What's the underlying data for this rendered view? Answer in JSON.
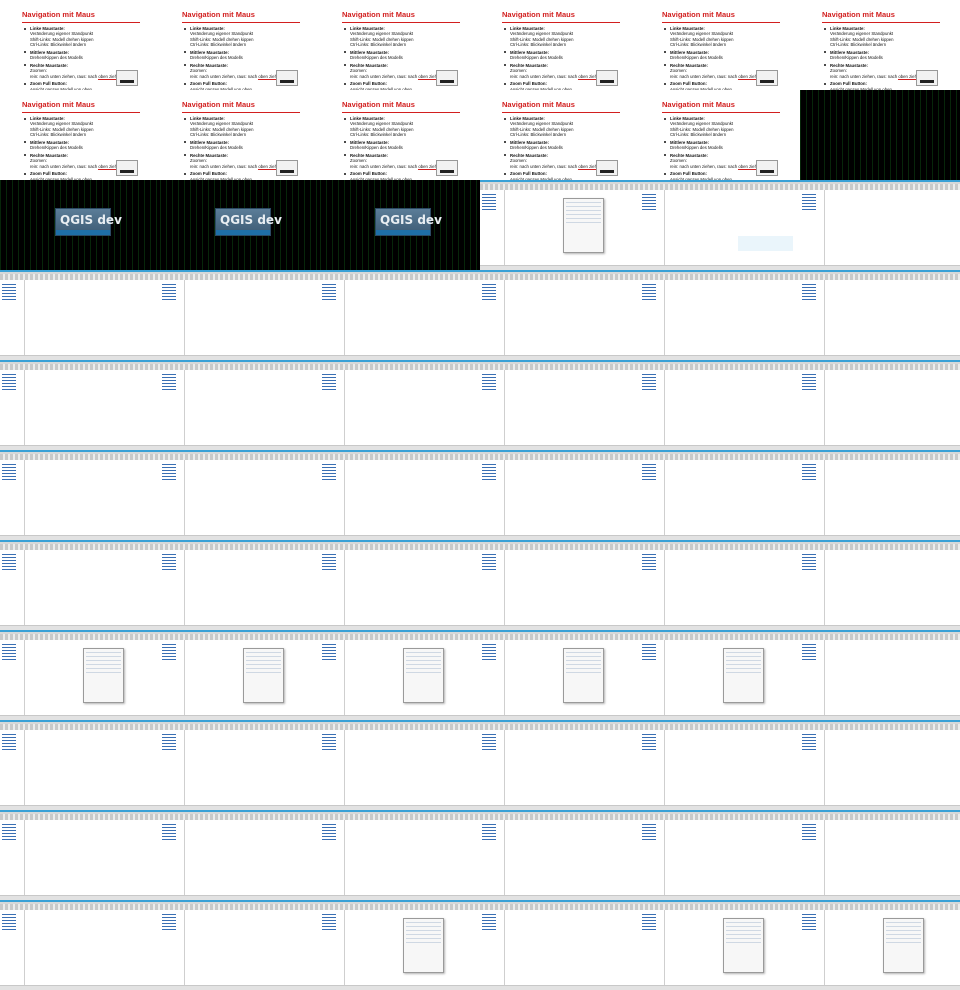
{
  "slide": {
    "title": "Navigation mit Maus",
    "bullets": [
      {
        "head": "Linke Maustaste:",
        "lines": [
          "Veränderung eigener Standpunkt",
          "Shift-Links: Modell drehen kippen",
          "Ctrl-Links: Blickwinkel ändern"
        ]
      },
      {
        "head": "Mittlere Maustaste:",
        "lines": [
          "Drehen/Kippen des Modells"
        ]
      },
      {
        "head": "Rechte Maustaste:",
        "lines": [
          "Zoomen:",
          "rein: nach unten ziehen, raus: nach oben ziehen"
        ]
      },
      {
        "head": "Zoom Full Button:",
        "lines": [
          "Ansicht ganzes Modell von oben"
        ]
      }
    ]
  },
  "splash": {
    "text": "QGIS dev"
  },
  "rows": [
    [
      "slide",
      "slide",
      "slide",
      "slide",
      "slide",
      "slide"
    ],
    [
      "slide",
      "slide",
      "slide",
      "slide",
      "slide",
      "black"
    ],
    [
      "splash",
      "splash",
      "splash",
      "app:welcome",
      "app:blue",
      "app:lines-green"
    ],
    [
      "app:lines-green2",
      "app:lines-green",
      "app:lines-green",
      "app:lines-green",
      "app:lines-green",
      "app:lines-green"
    ],
    [
      "app:lines-green",
      "app:lines-green",
      "app:lines-green",
      "app:lines-green",
      "app:lines-green",
      "app:lines-green"
    ],
    [
      "app:lines-green",
      "app:lines-green",
      "app:lines-green",
      "app:lines-white",
      "app:hill-gray",
      "app:hill-gray"
    ],
    [
      "app:hill-gray",
      "app:hill-gray",
      "app:hill-gray",
      "app:hill-gray",
      "app:hill-gray",
      "app:hill-gray"
    ],
    [
      "app:hill-dialog",
      "app:hill-dialog",
      "app:hill-dialog",
      "app:hill-dialog",
      "app:hill-dialog",
      "app:hill-mesh"
    ],
    [
      "app:hill-mesh",
      "app:hill-mesh",
      "app:ortho-terrain",
      "app:ortho-terrain",
      "app:ortho-terrain",
      "app:ortho-terrain"
    ],
    [
      "app:ortho-terrain",
      "app:ortho-terrain",
      "app:ortho-terrain",
      "app:ortho-terrain",
      "app:ortho-terrain",
      "app:ortho-terrain"
    ],
    [
      "app:ortho-terrain",
      "app:ortho-terrain",
      "app:ortho-dialog",
      "app:ortho-terrain",
      "app:ortho-dialog",
      "app:ortho-dialog"
    ]
  ]
}
